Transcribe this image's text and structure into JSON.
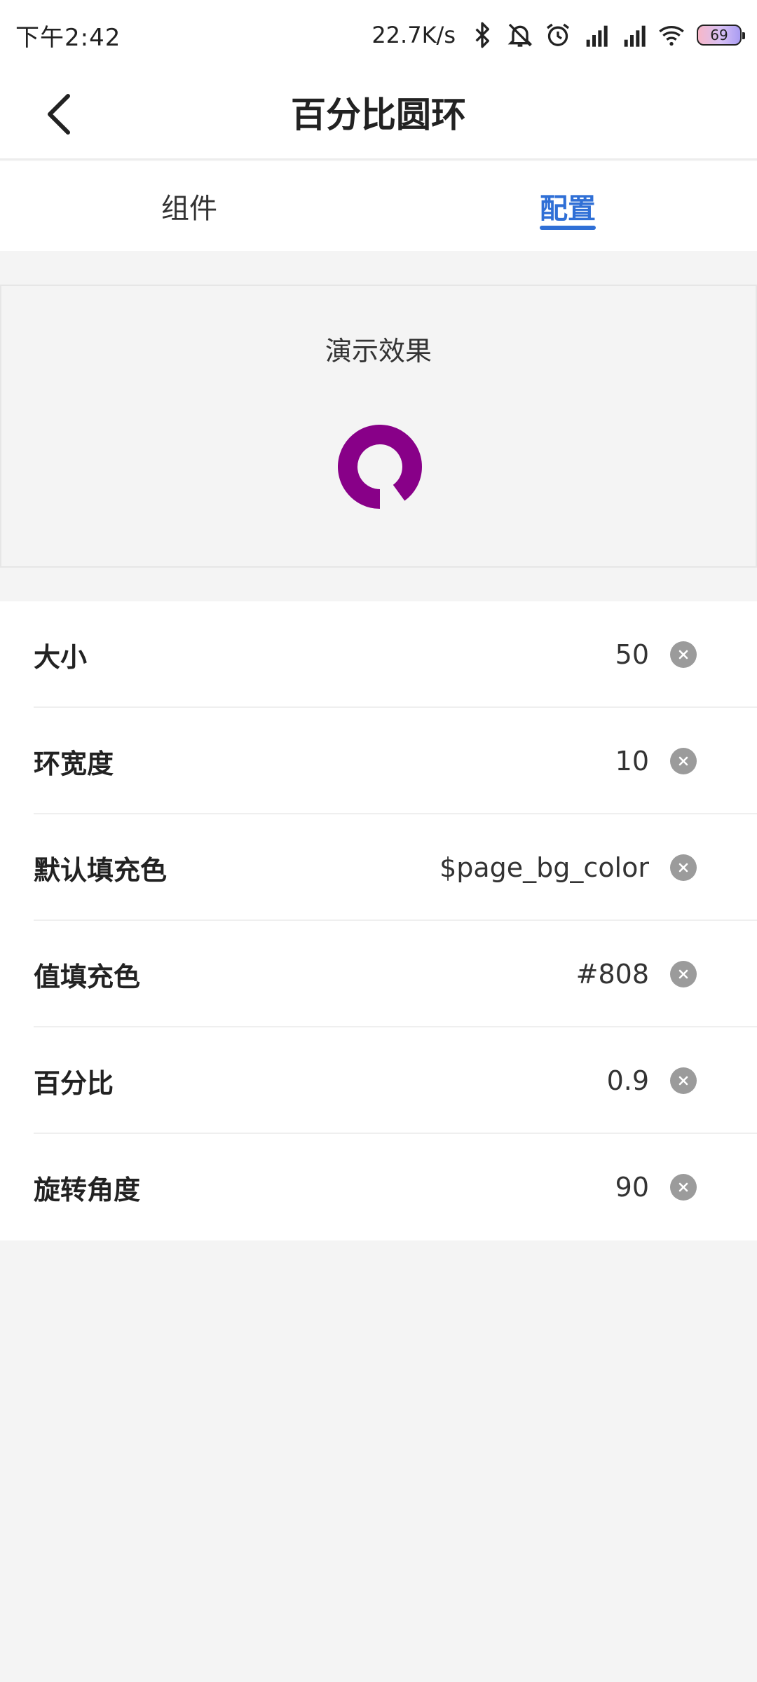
{
  "status_bar": {
    "time": "下午2:42",
    "net_speed": "22.7K/s",
    "icons": [
      "bluetooth-icon",
      "mute-bell-icon",
      "alarm-icon",
      "signal-hd-icon",
      "signal-hd-icon",
      "wifi-icon"
    ],
    "battery_level": "69"
  },
  "header": {
    "title": "百分比圆环",
    "back_icon": "chevron-left-icon"
  },
  "tabs": [
    {
      "label": "组件",
      "active": false
    },
    {
      "label": "配置",
      "active": true
    }
  ],
  "demo": {
    "title": "演示效果",
    "ring": {
      "percent": 0.9,
      "fill_color": "#808",
      "track_color": "#f4f4f4",
      "rotate_deg": 90
    }
  },
  "config": {
    "rows": [
      {
        "label": "大小",
        "value": "50"
      },
      {
        "label": "环宽度",
        "value": "10"
      },
      {
        "label": "默认填充色",
        "value": "$page_bg_color"
      },
      {
        "label": "值填充色",
        "value": "#808"
      },
      {
        "label": "百分比",
        "value": "0.9"
      },
      {
        "label": "旋转角度",
        "value": "90"
      }
    ],
    "clear_icon": "clear-circle-icon"
  },
  "colors": {
    "accent": "#2f6fd6",
    "ring_fill": "#880088",
    "page_bg": "#f4f4f4"
  }
}
